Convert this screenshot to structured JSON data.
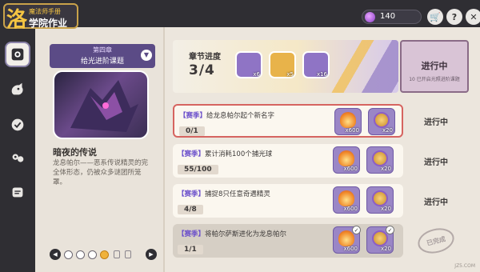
{
  "app": {
    "logo_sub": "魔法师手册",
    "logo_main": "学院作业",
    "gems": "140"
  },
  "sidebar": {
    "items": [
      {
        "icon": "magic-book-icon",
        "active": true
      },
      {
        "icon": "creature-icon",
        "active": false
      },
      {
        "icon": "badge-icon",
        "active": false
      },
      {
        "icon": "team-icon",
        "active": false
      },
      {
        "icon": "scroll-icon",
        "active": false
      }
    ]
  },
  "chapter": {
    "number": "第四章",
    "title": "给光进阶课题",
    "story_title": "暗夜的传说",
    "story_desc": "龙息帕尔——恶系传说精灵的完全体形态，仍被众多谜团所笼罩。"
  },
  "progress": {
    "label": "章节进度",
    "value": "3/4",
    "rewards": [
      {
        "icon": "crystal-icon",
        "qty": "x6"
      },
      {
        "icon": "coin-icon",
        "qty": "x5"
      },
      {
        "icon": "ticket-icon",
        "qty": "x16"
      }
    ],
    "status": "进行中",
    "status_sub": "10 已开启光照进阶课题"
  },
  "tasks": [
    {
      "tag": "【赛季】",
      "text": "给龙息帕尔起个新名字",
      "count": "0/1",
      "reward1": "x600",
      "reward2": "x20",
      "status": "进行中",
      "done": false
    },
    {
      "tag": "【赛季】",
      "text": "累计消耗100个捕光球",
      "count": "55/100",
      "reward1": "x600",
      "reward2": "x20",
      "status": "进行中",
      "done": false
    },
    {
      "tag": "【赛季】",
      "text": "捕捉8只任意奇遇精灵",
      "count": "4/8",
      "reward1": "x600",
      "reward2": "x20",
      "status": "进行中",
      "done": false
    },
    {
      "tag": "【赛季】",
      "text": "将帕尔萨斯进化为龙息帕尔",
      "count": "1/1",
      "reward1": "x600",
      "reward2": "x20",
      "status": "已完成",
      "done": true
    }
  ],
  "footer": {
    "watermark": "JZ5.COM"
  },
  "colors": {
    "accent": "#6a4ecb",
    "highlight": "#d66460",
    "dark": "#2f2e33"
  }
}
